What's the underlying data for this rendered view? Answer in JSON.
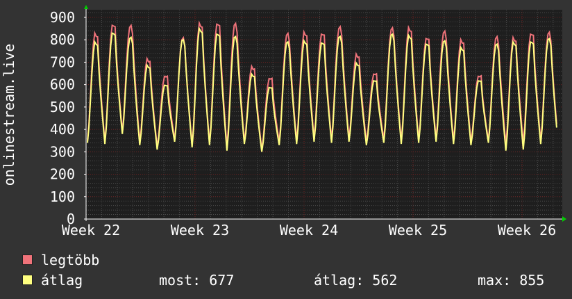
{
  "chart_data": {
    "type": "line",
    "ylabel": "onlinestream.live",
    "ylim": [
      0,
      900
    ],
    "y_ticks": [
      0,
      100,
      200,
      300,
      400,
      500,
      600,
      700,
      800,
      900
    ],
    "x_ticks": [
      "Week 22",
      "Week 23",
      "Week 24",
      "Week 25",
      "Week 26"
    ],
    "grid": true,
    "legend_placement": "bottom",
    "colors": {
      "background": "#333333",
      "plot_bg": "#1e1e1e",
      "grid_major": "#6a1f1f",
      "grid_minor": "#4a4a4a",
      "axis": "#ffffff",
      "arrow": "#00cc00",
      "max_series": "#f0737a",
      "avg_series": "#ffff80"
    },
    "daily": {
      "peaks_max": [
        835,
        870,
        860,
        720,
        640,
        805,
        880,
        875,
        870,
        685,
        630,
        825,
        840,
        830,
        855,
        740,
        650,
        850,
        860,
        810,
        835,
        805,
        640,
        810,
        815,
        830,
        830
      ],
      "troughs_max": [
        350,
        345,
        390,
        345,
        320,
        355,
        335,
        340,
        325,
        345,
        310,
        345,
        350,
        360,
        355,
        360,
        345,
        355,
        350,
        355,
        360,
        350,
        345,
        350,
        335,
        340,
        350
      ],
      "peaks_avg": [
        795,
        835,
        810,
        690,
        600,
        800,
        855,
        830,
        815,
        650,
        590,
        790,
        800,
        790,
        815,
        700,
        620,
        825,
        825,
        785,
        795,
        770,
        620,
        780,
        795,
        795,
        805
      ],
      "troughs_avg": [
        340,
        335,
        380,
        330,
        310,
        345,
        320,
        330,
        305,
        335,
        300,
        330,
        335,
        345,
        340,
        345,
        330,
        340,
        335,
        340,
        345,
        335,
        330,
        340,
        305,
        310,
        335
      ]
    },
    "series": [
      {
        "name": "legtöbb",
        "color": "#f0737a"
      },
      {
        "name": "átlag",
        "color": "#ffff80"
      }
    ]
  },
  "legend": {
    "max_label": "legtöbb",
    "avg_label": "átlag",
    "current": "most: 677",
    "average": "átlag: 562",
    "maximum": "max: 855"
  }
}
